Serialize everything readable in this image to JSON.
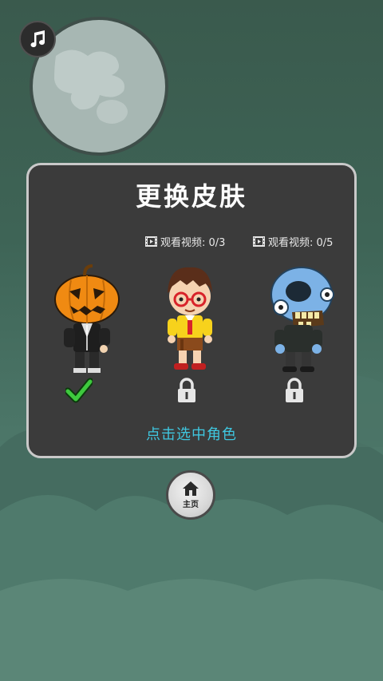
{
  "title": "更换皮肤",
  "hint": "点击选中角色",
  "home_label": "主页",
  "characters": [
    {
      "name": "pumpkin",
      "status": "selected",
      "video_label": ""
    },
    {
      "name": "boy",
      "status": "locked",
      "video_label": "观看视频: 0/3"
    },
    {
      "name": "zombie",
      "status": "locked",
      "video_label": "观看视频: 0/5"
    }
  ],
  "colors": {
    "panel": "#3b3b3b",
    "panel_border": "#c9c9c9",
    "hint": "#3fc7e0",
    "check": "#3ec93e",
    "background": "#3e6456"
  },
  "icons": {
    "music": "music-note-icon",
    "home": "home-icon",
    "film": "film-icon",
    "lock": "lock-icon",
    "check": "checkmark-icon"
  }
}
